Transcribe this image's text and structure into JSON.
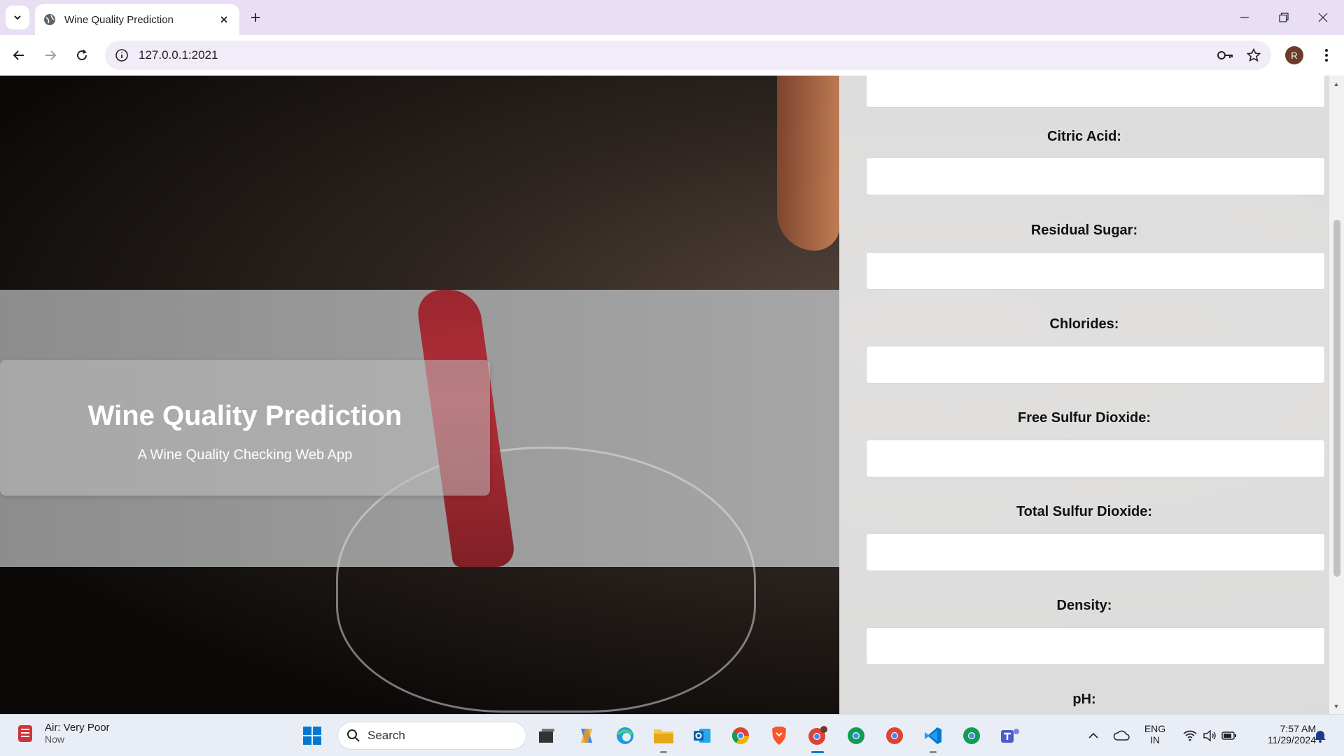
{
  "browser": {
    "tab_title": "Wine Quality Prediction",
    "url": "127.0.0.1:2021",
    "avatar_letter": "R"
  },
  "hero": {
    "title": "Wine Quality Prediction",
    "subtitle": "A Wine Quality Checking Web App"
  },
  "form": {
    "fields": [
      {
        "label": "Citric Acid:",
        "value": ""
      },
      {
        "label": "Residual Sugar:",
        "value": ""
      },
      {
        "label": "Chlorides:",
        "value": ""
      },
      {
        "label": "Free Sulfur Dioxide:",
        "value": ""
      },
      {
        "label": "Total Sulfur Dioxide:",
        "value": ""
      },
      {
        "label": "Density:",
        "value": ""
      },
      {
        "label": "pH:",
        "value": ""
      }
    ]
  },
  "taskbar": {
    "weather_line1": "Air: Very Poor",
    "weather_line2": "Now",
    "search_label": "Search",
    "lang_line1": "ENG",
    "lang_line2": "IN",
    "time": "7:57 AM",
    "date": "11/29/2024"
  },
  "colors": {
    "tabbar_bg": "#e8dff5",
    "omnibox_bg": "#f1ecf7",
    "wine_red": "#9c1a24",
    "taskbar_bg": "#e9eef6"
  }
}
